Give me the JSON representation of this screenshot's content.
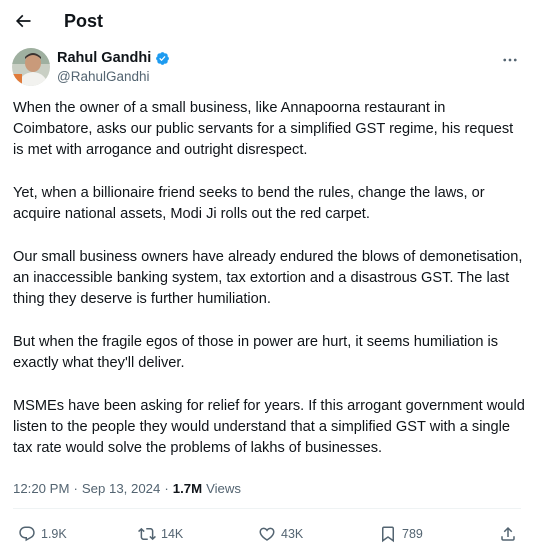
{
  "header": {
    "title": "Post"
  },
  "author": {
    "display_name": "Rahul Gandhi",
    "handle": "@RahulGandhi",
    "verified": true
  },
  "tweet": {
    "paragraphs": [
      "When the owner of a small business, like Annapoorna restaurant in Coimbatore, asks our public servants for a simplified GST regime, his request is met with arrogance and outright disrespect.",
      "Yet, when a billionaire friend seeks to bend the rules, change the laws, or acquire national assets, Modi Ji rolls out the red carpet.",
      "Our small business owners have already endured the blows of demonetisation, an inaccessible banking system, tax extortion and a disastrous GST. The last thing they deserve is further humiliation.",
      "But when the fragile egos of those in power are hurt, it seems humiliation is exactly what they'll deliver.",
      "MSMEs have been asking for relief for years. If this arrogant government would listen to the people they would understand that a simplified GST with a single tax rate would solve the problems of lakhs of businesses."
    ]
  },
  "meta": {
    "time": "12:20 PM",
    "separator1": "·",
    "date": "Sep 13, 2024",
    "separator2": "·",
    "views_count": "1.7M",
    "views_label": "Views"
  },
  "actions": {
    "replies": "1.9K",
    "reposts": "14K",
    "likes": "43K",
    "bookmarks": "789"
  },
  "colors": {
    "text": "#0f1419",
    "secondary": "#536471",
    "verified": "#1d9bf0",
    "divider": "#eff3f4"
  }
}
